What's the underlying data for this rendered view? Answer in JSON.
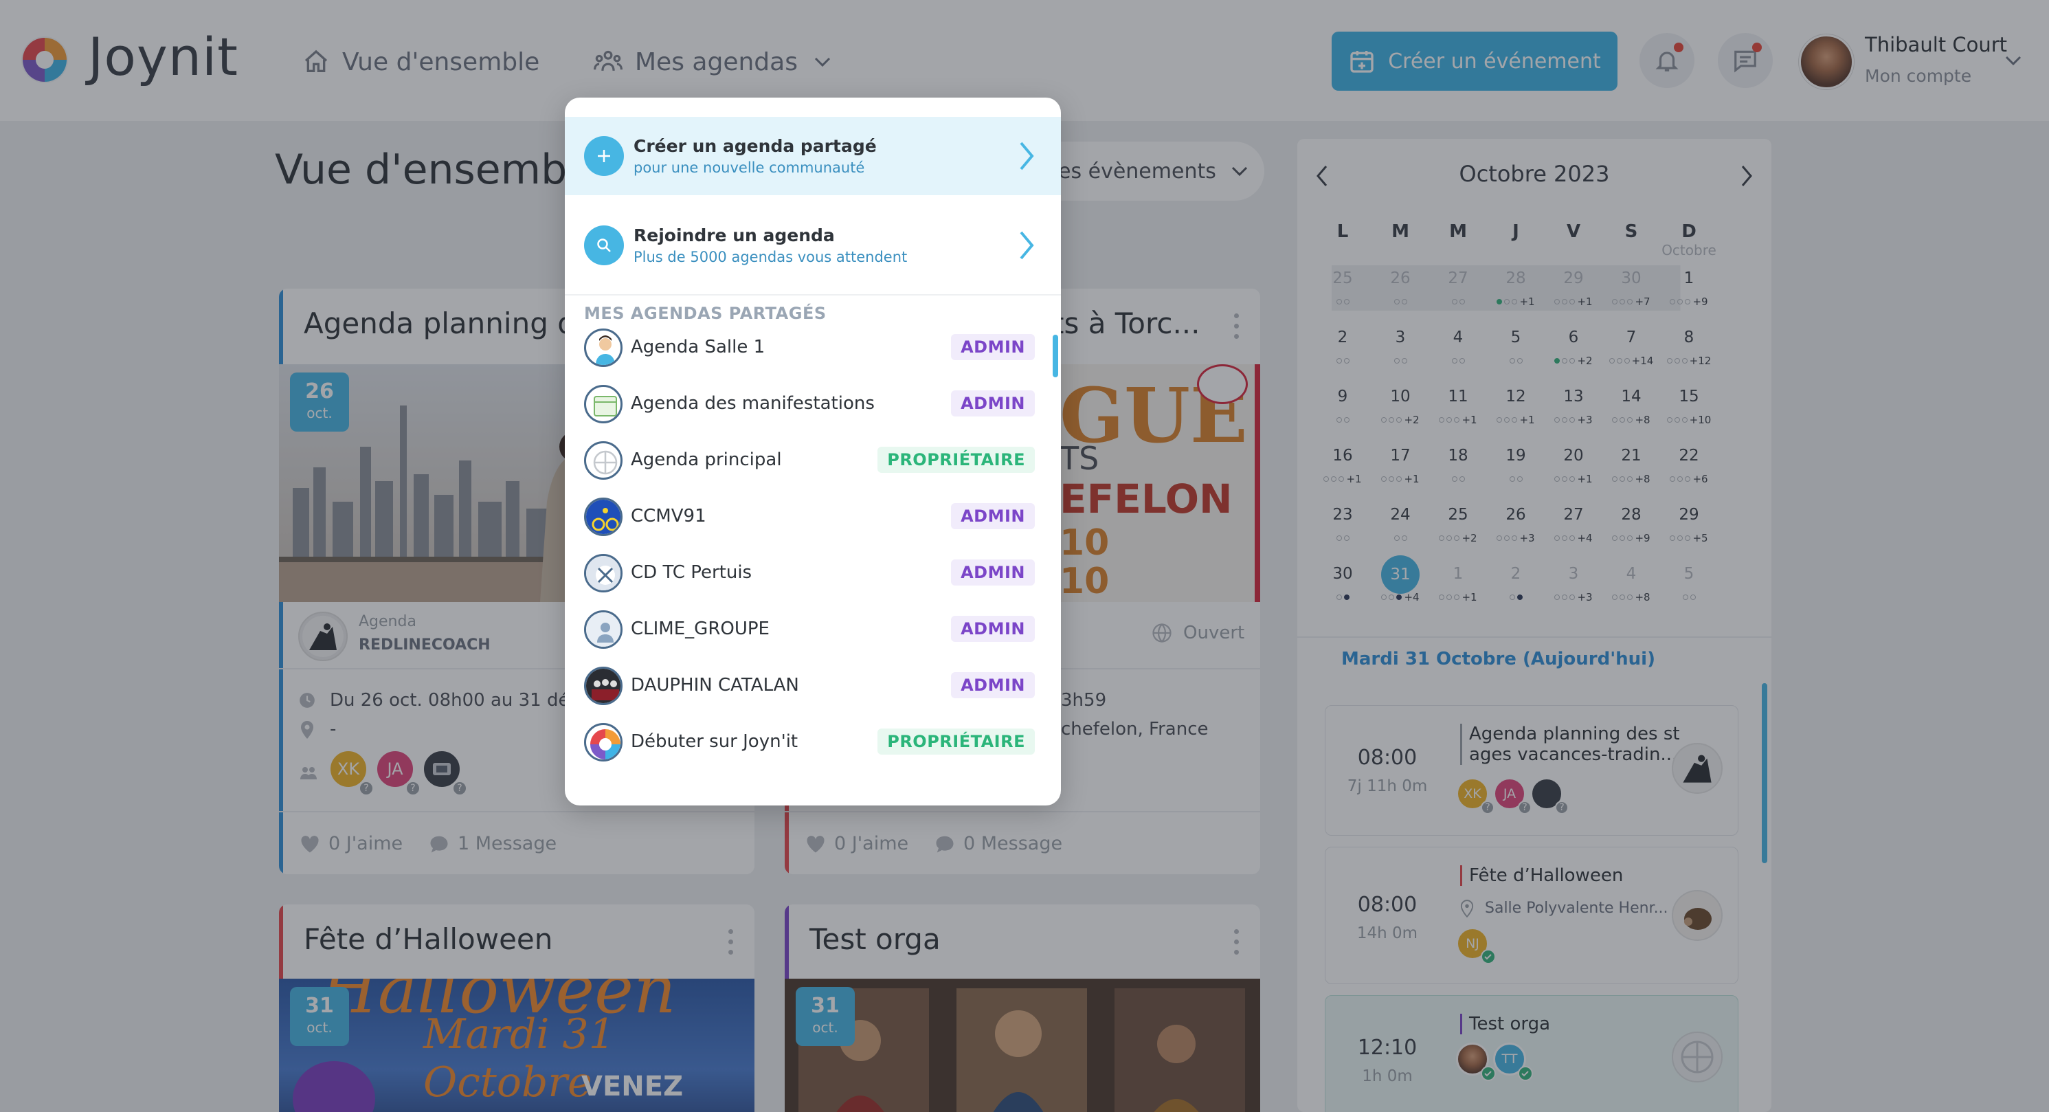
{
  "app": {
    "name": "Joynit"
  },
  "nav": {
    "overview": "Vue d'ensemble",
    "my_calendars": "Mes agendas"
  },
  "header": {
    "create_event": "Créer un événement",
    "user_name": "Thibault Court",
    "user_sub": "Mon compte"
  },
  "page": {
    "title": "Vue d'ensemble",
    "filter_label": "es évènements"
  },
  "cards": [
    {
      "title": "Agenda planning de",
      "day": "26",
      "month": "oct.",
      "agenda_label": "Agenda",
      "agenda_name": "REDLINECOACH",
      "when": "Du 26 oct. 08h00 au 31 déc. 18",
      "where": "-",
      "participants": [
        "XK",
        "JA"
      ],
      "likes": "0 J'aime",
      "messages": "1 Message"
    },
    {
      "title": "ts à Torc...",
      "visibility": "Ouvert",
      "when_tail": "3h59",
      "where_tail": "chefelon, France",
      "poster_lines": [
        "GUE",
        "TS",
        "EFELON",
        "10",
        "10"
      ],
      "likes": "0 J'aime",
      "messages": "0 Message"
    },
    {
      "title": "Fête d’Halloween",
      "day": "31",
      "month": "oct.",
      "poster_top": "Halloween",
      "poster_date": "Mardi 31 Octobre",
      "poster_cta": "VENEZ"
    },
    {
      "title": "Test orga",
      "day": "31",
      "month": "oct."
    }
  ],
  "calendar": {
    "month_label": "Octobre 2023",
    "dow": [
      "L",
      "M",
      "M",
      "J",
      "V",
      "S",
      "D"
    ],
    "dow_sub": "Octobre",
    "weeks": [
      [
        {
          "d": "25",
          "o": true,
          "x": ""
        },
        {
          "d": "26",
          "o": true,
          "x": ""
        },
        {
          "d": "27",
          "o": true,
          "x": ""
        },
        {
          "d": "28",
          "o": true,
          "x": "+1"
        },
        {
          "d": "29",
          "o": true,
          "x": "+1"
        },
        {
          "d": "30",
          "o": true,
          "x": "+7"
        },
        {
          "d": "1",
          "o": false,
          "x": "+9"
        }
      ],
      [
        {
          "d": "2",
          "o": false,
          "x": ""
        },
        {
          "d": "3",
          "o": false,
          "x": ""
        },
        {
          "d": "4",
          "o": false,
          "x": ""
        },
        {
          "d": "5",
          "o": false,
          "x": ""
        },
        {
          "d": "6",
          "o": false,
          "x": "+2"
        },
        {
          "d": "7",
          "o": false,
          "x": "+14"
        },
        {
          "d": "8",
          "o": false,
          "x": "+12"
        }
      ],
      [
        {
          "d": "9",
          "o": false,
          "x": ""
        },
        {
          "d": "10",
          "o": false,
          "x": "+2"
        },
        {
          "d": "11",
          "o": false,
          "x": "+1"
        },
        {
          "d": "12",
          "o": false,
          "x": "+1"
        },
        {
          "d": "13",
          "o": false,
          "x": "+3"
        },
        {
          "d": "14",
          "o": false,
          "x": "+8"
        },
        {
          "d": "15",
          "o": false,
          "x": "+10"
        }
      ],
      [
        {
          "d": "16",
          "o": false,
          "x": "+1"
        },
        {
          "d": "17",
          "o": false,
          "x": "+1"
        },
        {
          "d": "18",
          "o": false,
          "x": ""
        },
        {
          "d": "19",
          "o": false,
          "x": ""
        },
        {
          "d": "20",
          "o": false,
          "x": "+1"
        },
        {
          "d": "21",
          "o": false,
          "x": "+8"
        },
        {
          "d": "22",
          "o": false,
          "x": "+6"
        }
      ],
      [
        {
          "d": "23",
          "o": false,
          "x": ""
        },
        {
          "d": "24",
          "o": false,
          "x": ""
        },
        {
          "d": "25",
          "o": false,
          "x": "+2"
        },
        {
          "d": "26",
          "o": false,
          "x": "+3"
        },
        {
          "d": "27",
          "o": false,
          "x": "+4"
        },
        {
          "d": "28",
          "o": false,
          "x": "+9"
        },
        {
          "d": "29",
          "o": false,
          "x": "+5"
        }
      ],
      [
        {
          "d": "30",
          "o": false,
          "x": ""
        },
        {
          "d": "31",
          "o": false,
          "x": "+4"
        },
        {
          "d": "1",
          "o": true,
          "x": "+1"
        },
        {
          "d": "2",
          "o": true,
          "x": ""
        },
        {
          "d": "3",
          "o": true,
          "x": "+3"
        },
        {
          "d": "4",
          "o": true,
          "x": "+8"
        },
        {
          "d": "5",
          "o": true,
          "x": ""
        }
      ]
    ],
    "today_label": "Mardi 31 Octobre (Aujourd'hui)",
    "events": [
      {
        "time": "08:00",
        "dur": "7j 11h 0m",
        "title1": "Agenda planning des st",
        "title2": "ages vacances-tradin...",
        "participants": [
          "XK",
          "JA"
        ]
      },
      {
        "time": "08:00",
        "dur": "14h 0m",
        "title1": "Fête d’Halloween",
        "place": "Salle Polyvalente Henr...",
        "participants": [
          "NJ"
        ]
      },
      {
        "time": "12:10",
        "dur": "1h 0m",
        "title1": "Test orga",
        "participants": [
          "TT"
        ]
      }
    ]
  },
  "dropdown": {
    "create_title": "Créer un agenda partagé",
    "create_sub": "pour une nouvelle communauté",
    "join_title": "Rejoindre un agenda",
    "join_sub": "Plus de 5000 agendas vous attendent",
    "section": "MES AGENDAS PARTAGÉS",
    "agendas": [
      {
        "name": "Agenda Salle 1",
        "role": "ADMIN",
        "icon": "person-icon"
      },
      {
        "name": "Agenda des manifestations",
        "role": "ADMIN",
        "icon": "calendar-icon"
      },
      {
        "name": "Agenda principal",
        "role": "PROPRIÉTAIRE",
        "icon": "placeholder-icon"
      },
      {
        "name": "CCMV91",
        "role": "ADMIN",
        "icon": "cyclist-icon"
      },
      {
        "name": "CD TC Pertuis",
        "role": "ADMIN",
        "icon": "tennis-icon"
      },
      {
        "name": "CLIME_GROUPE",
        "role": "ADMIN",
        "icon": "group-icon"
      },
      {
        "name": "DAUPHIN CATALAN",
        "role": "ADMIN",
        "icon": "team-photo-icon"
      },
      {
        "name": "Débuter sur Joyn'it",
        "role": "PROPRIÉTAIRE",
        "icon": "joynit-logo-icon"
      }
    ]
  },
  "colors": {
    "accent": "#47b6e3",
    "admin": "#7b45c8",
    "owner": "#2bb57a",
    "danger": "#e7473a"
  }
}
